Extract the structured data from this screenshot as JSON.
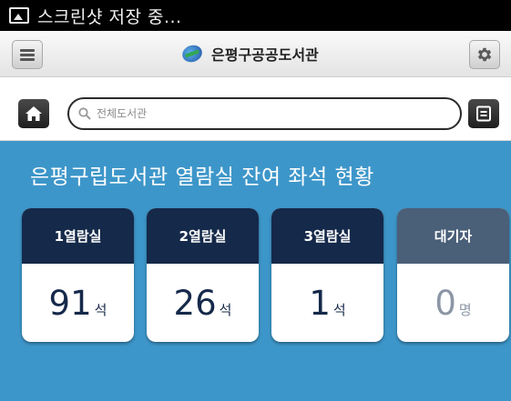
{
  "status_bar": {
    "text": "스크린샷 저장 중..."
  },
  "header": {
    "title": "은평구공공도서관"
  },
  "search": {
    "placeholder": "전체도서관"
  },
  "main": {
    "title": "은평구립도서관 열람실 잔여 좌석 현황",
    "cards": [
      {
        "label": "1열람실",
        "value": "91",
        "unit": "석"
      },
      {
        "label": "2열람실",
        "value": "26",
        "unit": "석"
      },
      {
        "label": "3열람실",
        "value": "1",
        "unit": "석"
      },
      {
        "label": "대기자",
        "value": "0",
        "unit": "명"
      }
    ]
  },
  "colors": {
    "background": "#3d96c9",
    "card_header": "#15294a",
    "waiting_header": "#4a5f78"
  }
}
